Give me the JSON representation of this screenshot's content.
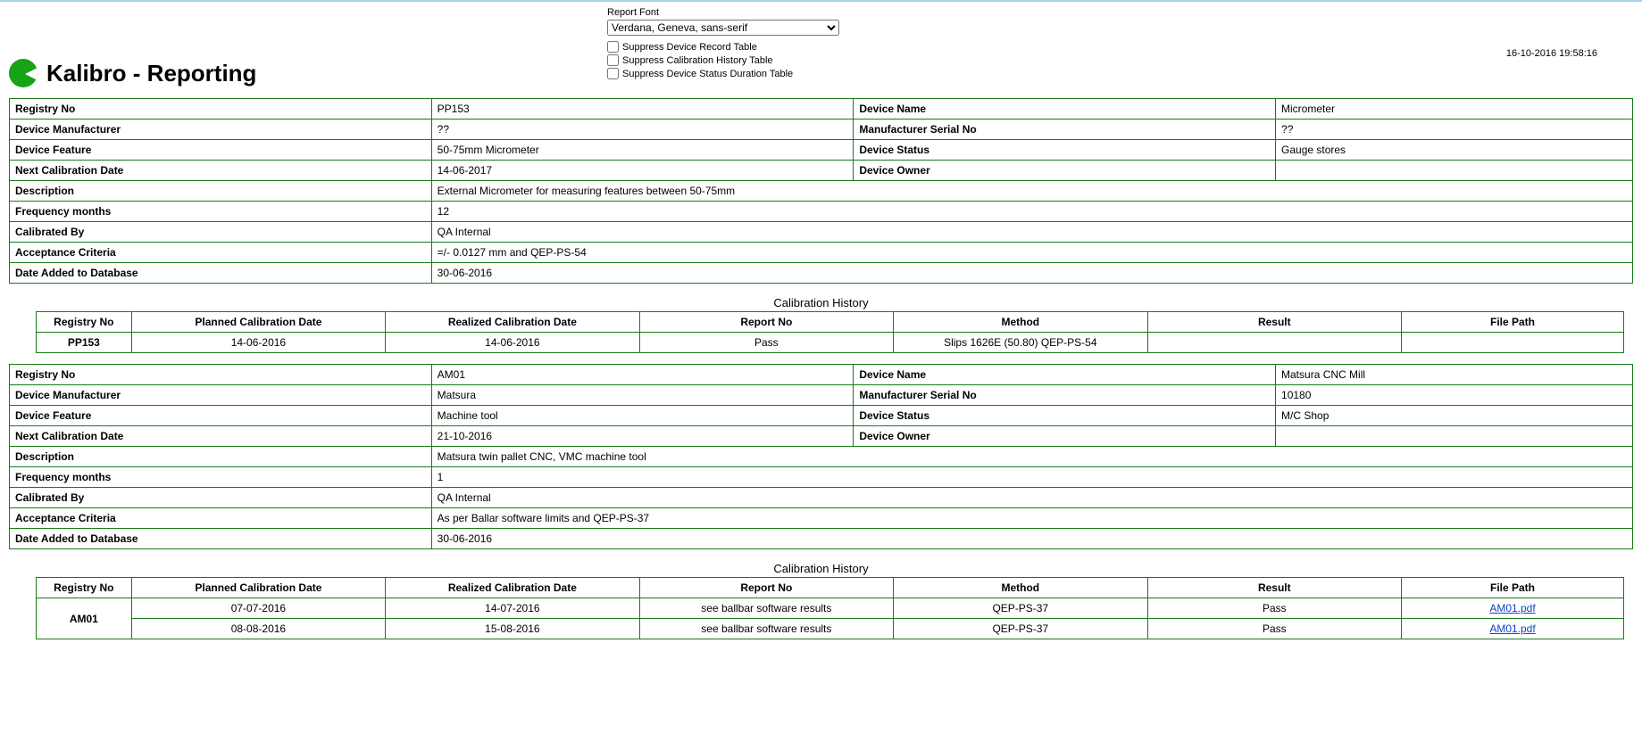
{
  "header": {
    "title": "Kalibro - Reporting",
    "report_font_label": "Report Font",
    "report_font_value": "Verdana, Geneva, sans-serif",
    "suppress_device_record": "Suppress Device Record Table",
    "suppress_cal_history": "Suppress Calibration History Table",
    "suppress_status_duration": "Suppress Device Status Duration Table",
    "timestamp": "16-10-2016 19:58:16"
  },
  "labels": {
    "registry_no": "Registry No",
    "device_name": "Device Name",
    "device_manufacturer": "Device Manufacturer",
    "manufacturer_serial_no": "Manufacturer Serial No",
    "device_feature": "Device Feature",
    "device_status": "Device Status",
    "next_calibration_date": "Next Calibration Date",
    "device_owner": "Device Owner",
    "description": "Description",
    "frequency_months": "Frequency months",
    "calibrated_by": "Calibrated By",
    "acceptance_criteria": "Acceptance Criteria",
    "date_added": "Date Added to Database",
    "calibration_history": "Calibration History",
    "planned_cal_date": "Planned Calibration Date",
    "realized_cal_date": "Realized Calibration Date",
    "report_no": "Report No",
    "method": "Method",
    "result": "Result",
    "file_path": "File Path"
  },
  "devices": [
    {
      "registry_no": "PP153",
      "device_name": "Micrometer",
      "device_manufacturer": "??",
      "manufacturer_serial_no": "??",
      "device_feature": "50-75mm Micrometer",
      "device_status": "Gauge stores",
      "next_calibration_date": "14-06-2017",
      "device_owner": "",
      "description": "External Micrometer for measuring features between 50-75mm",
      "frequency_months": "12",
      "calibrated_by": "QA Internal",
      "acceptance_criteria": "=/- 0.0127 mm and QEP-PS-54",
      "date_added": "30-06-2016",
      "history": [
        {
          "registry_no": "PP153",
          "planned": "14-06-2016",
          "realized": "14-06-2016",
          "report_no": "Pass",
          "method": "Slips 1626E (50.80) QEP-PS-54",
          "result": "",
          "file_path": ""
        }
      ]
    },
    {
      "registry_no": "AM01",
      "device_name": "Matsura CNC Mill",
      "device_manufacturer": "Matsura",
      "manufacturer_serial_no": "10180",
      "device_feature": "Machine tool",
      "device_status": "M/C Shop",
      "next_calibration_date": "21-10-2016",
      "device_owner": "",
      "description": "Matsura twin pallet CNC, VMC machine tool",
      "frequency_months": "1",
      "calibrated_by": "QA Internal",
      "acceptance_criteria": "As per Ballar software limits and QEP-PS-37",
      "date_added": "30-06-2016",
      "history": [
        {
          "registry_no": "AM01",
          "planned": "07-07-2016",
          "realized": "14-07-2016",
          "report_no": "see ballbar software results",
          "method": "QEP-PS-37",
          "result": "Pass",
          "file_path": "AM01.pdf"
        },
        {
          "registry_no": "",
          "planned": "08-08-2016",
          "realized": "15-08-2016",
          "report_no": "see ballbar software results",
          "method": "QEP-PS-37",
          "result": "Pass",
          "file_path": "AM01.pdf"
        }
      ]
    }
  ]
}
